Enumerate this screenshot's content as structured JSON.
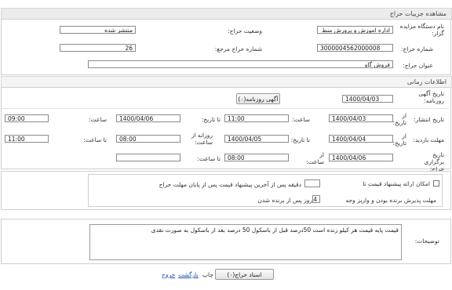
{
  "header": {
    "title": "مشاهده جزییات حراج"
  },
  "general": {
    "org_label": "نام دستگاه مزایده گزار:",
    "org_value": "اداره اموزش و پرورش منط",
    "status_label": "وضعیت حراج:",
    "status_value": "منتشر شده",
    "auction_number_label": "شماره حراج:",
    "auction_number_value": "3000004562000008",
    "ref_number_label": "شماره حراج مرجع:",
    "ref_number_value": "26",
    "auction_title_label": "عنوان حراج:",
    "auction_title_value": "فروش گاو"
  },
  "timing": {
    "section_title": "اطلاعات زمانی",
    "newspaper_date_label": "تاریخ آگهی روزنامه:",
    "newspaper_date_value": "1400/04/03",
    "newspaper_button": "آگهی روزنامه(۰)",
    "publish_label": "تاریخ انتشار:",
    "from_date_label": "از تاریخ:",
    "to_date_label": "تا تاریخ:",
    "time_label": "ساعت:",
    "to_time_label": "تا ساعت:",
    "daily_from_label": "روزانه از ساعت:",
    "from_time_label": "از ساعت:",
    "publish_from_date": "1400/04/03",
    "publish_from_time": "11:00",
    "publish_to_date": "1400/04/06",
    "publish_to_time": "09:00",
    "visit_label": "مهلت بازدید:",
    "visit_from_date": "1400/04/04",
    "visit_to_date": "1400/04/05",
    "visit_daily_from": "08:00",
    "visit_to_time": "11:00",
    "hold_label": "تاریخ برگزاری حراج:",
    "hold_date": "1400/04/06",
    "hold_from_time": "08:00",
    "hold_to_time": ""
  },
  "options": {
    "price_offer_label": "امکان ارائه پیشنهاد قیمت تا",
    "price_offer_minutes": "",
    "price_offer_suffix": "دقیقه پس از آخرین پیشنهاد قیمت پس از پایان مهلت حراج",
    "winner_deadline_label": "مهلت پذیرش برنده بودن و واریز وجه",
    "winner_deadline_days": "4",
    "winner_deadline_suffix": "روز پس از برنده شدن"
  },
  "description": {
    "label": "توضیحات:",
    "text": "قیمت پایه قیمت هر کیلو زنده است 50درصد قبل از باسکول 50 درصد بعد از باسکول به صورت نقدی"
  },
  "footer": {
    "docs_button": "اسناد حراج(۰)",
    "print_label": "چاپ",
    "back_link": "بازگشت",
    "exit_link": "خروج"
  },
  "colors": {
    "header_bg": "#ececec",
    "link": "#1a4fb0",
    "border": "#cfcfcf"
  }
}
